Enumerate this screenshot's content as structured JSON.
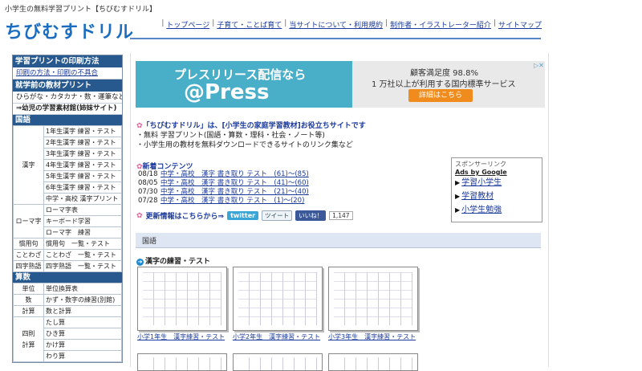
{
  "site": {
    "topline": "小学生の無料学習プリント【ちびむすドリル】",
    "logo": "ちびむすドリル"
  },
  "topnav": [
    "トップページ",
    "子育て・ことば育て",
    "当サイトについて・利用規約",
    "制作者・イラストレーター紹介",
    "サイトマップ"
  ],
  "sidebar": {
    "head1": "学習プリントの印刷方法",
    "item1": "印刷の方法・印刷の不具合",
    "head2": "就学前の教材プリント",
    "item2": "ひらがな・カタカナ・数・運筆など",
    "item3": "⇒幼児の学習素材館(姉妹サイト)",
    "head_kokugo": "国語",
    "kanji_cat": "漢字",
    "kanji_items": [
      "1年生漢字 練習・テスト",
      "2年生漢字 練習・テスト",
      "3年生漢字 練習・テスト",
      "4年生漢字 練習・テスト",
      "5年生漢字 練習・テスト",
      "6年生漢字 練習・テスト",
      "中学・高校 漢字プリント"
    ],
    "romaji_cat": "ローマ字",
    "romaji_items": [
      "ローマ字表",
      "キーボード学習",
      "ローマ字　練習"
    ],
    "misc": [
      {
        "cat": "慣用句",
        "item": "慣用句　一覧・テスト"
      },
      {
        "cat": "ことわざ",
        "item": "ことわざ　一覧・テスト"
      },
      {
        "cat": "四字熟語",
        "item": "四字熟語　一覧・テスト"
      }
    ],
    "head_sansu": "算数",
    "sansu_rows": [
      {
        "cat": "単位",
        "item": "単位換算表"
      },
      {
        "cat": "数",
        "item": "かず・数字の練習(別館)"
      },
      {
        "cat": "計算",
        "item": "数と計算"
      }
    ],
    "shisoku_cat": "四則\n計算",
    "shisoku_items": [
      "たし算",
      "ひき算",
      "かけ算",
      "わり算"
    ]
  },
  "ad": {
    "title": "プレスリリース配信なら",
    "brand": "@Press",
    "r1": "顧客満足度 98.8%",
    "r2": "1 万社以上が利用する国内標準サービス",
    "button": "詳細はこちら",
    "close": "▷✕"
  },
  "intro": {
    "title": "「ちびむすドリル」は、[小学生の家庭学習教材]お役立ちサイトです",
    "line1": "・無料 学習プリント(国語・算数・理科・社会・ノート等)",
    "line2": "・小学生用の教材を無料ダウンロードできるサイトのリンク集など"
  },
  "news": {
    "head": "新着コンテンツ",
    "rows": [
      {
        "date": "08/18",
        "text": "中学・高校　漢字 書き取り テスト　(61)～(85)"
      },
      {
        "date": "08/05",
        "text": "中学・高校　漢字 書き取り テスト　(41)～(60)"
      },
      {
        "date": "07/30",
        "text": "中学・高校　漢字 書き取り テスト　(21)～(40)"
      },
      {
        "date": "07/28",
        "text": "中学・高校　漢字 書き取り テスト　(1)～(20)"
      }
    ]
  },
  "update": {
    "text": "更新情報はこちらから⇒",
    "twitter": "twitter",
    "tweet": "ツイート",
    "like": "いいね！",
    "count": "1,147"
  },
  "sponsor": {
    "head": "スポンサーリンク",
    "by": "Ads by Google",
    "links": [
      "学習小学生",
      "学習教材",
      "小学生勉強"
    ]
  },
  "section": {
    "bar": "国語",
    "kanji_head": "漢字の練習・テスト"
  },
  "thumbs": [
    "小学1年生　漢字練習・テスト",
    "小学2年生　漢字練習・テスト",
    "小学3年生　漢字練習・テスト"
  ]
}
